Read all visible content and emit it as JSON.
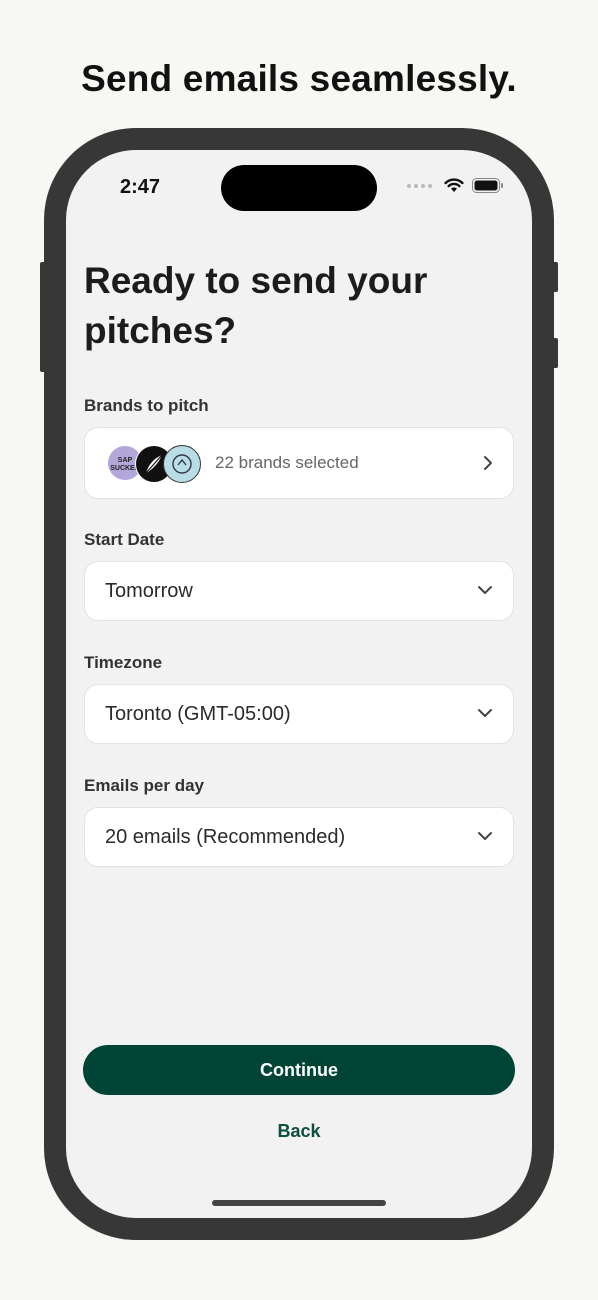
{
  "headline": "Send emails seamlessly.",
  "status_bar": {
    "time": "2:47"
  },
  "screen": {
    "title": "Ready to send your pitches?",
    "brands": {
      "label": "Brands to pitch",
      "selected_text": "22 brands selected",
      "first_avatar_text": "SAP SUCKER"
    },
    "start_date": {
      "label": "Start Date",
      "value": "Tomorrow"
    },
    "timezone": {
      "label": "Timezone",
      "value": "Toronto (GMT-05:00)"
    },
    "emails_per_day": {
      "label": "Emails per day",
      "value": "20 emails (Recommended)"
    },
    "continue_label": "Continue",
    "back_label": "Back"
  },
  "colors": {
    "primary": "#004436",
    "background": "#f2f2f2",
    "frame": "#373737"
  }
}
